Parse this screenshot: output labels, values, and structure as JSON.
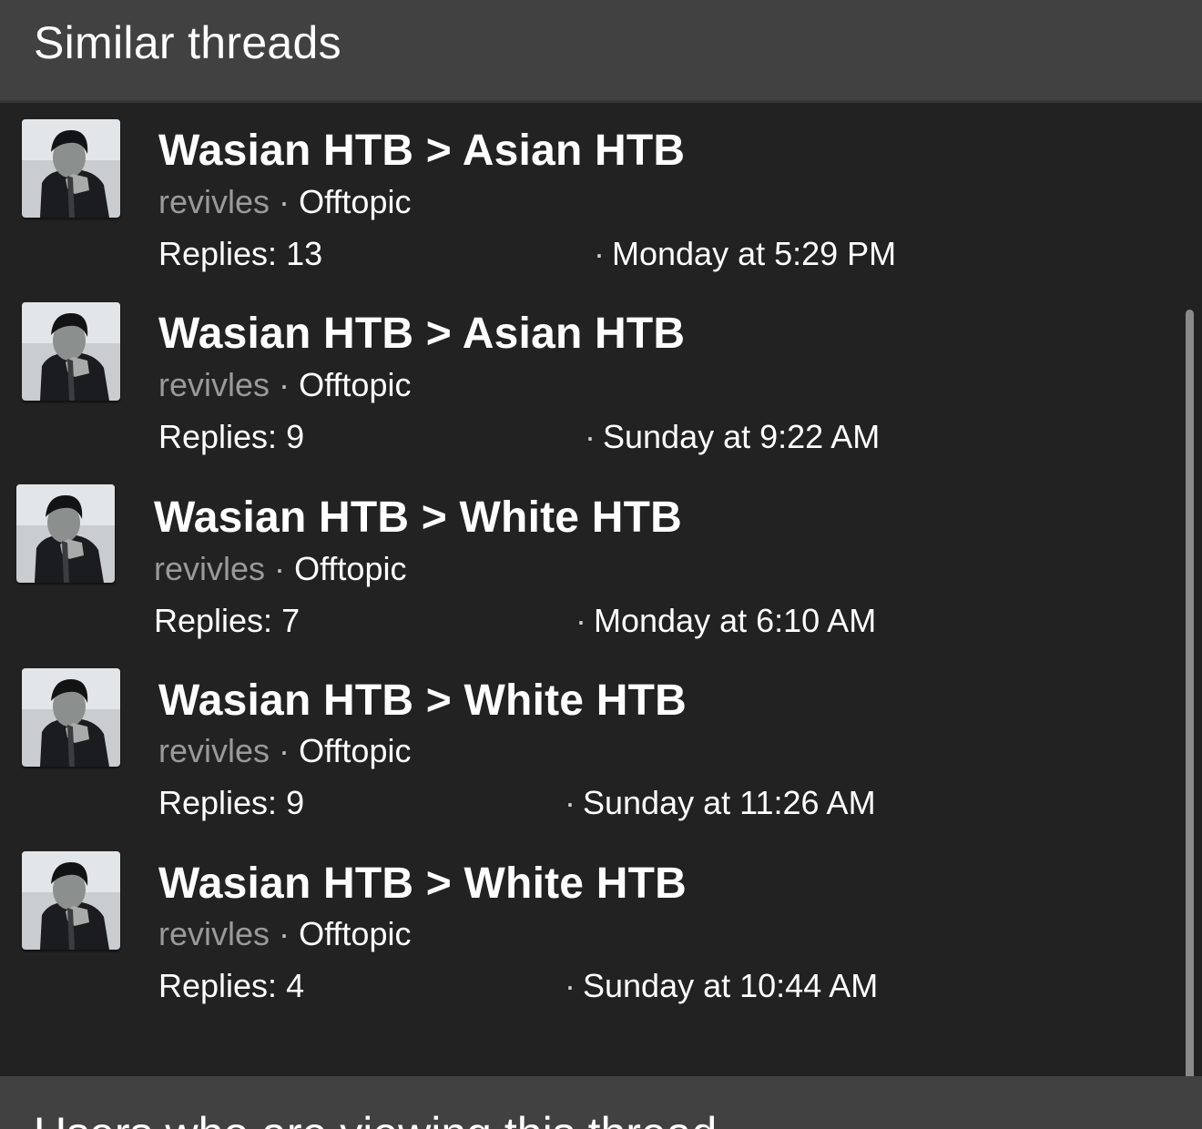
{
  "section": {
    "title": "Similar threads"
  },
  "threads": [
    {
      "title": "Wasian HTB > Asian HTB",
      "author": "revivles",
      "separator": "·",
      "forum": "Offtopic",
      "replies": "Replies: 13",
      "date": "Monday at 5:29 PM"
    },
    {
      "title": "Wasian HTB > Asian HTB",
      "author": "revivles",
      "separator": "·",
      "forum": "Offtopic",
      "replies": "Replies: 9",
      "date": "Sunday at 9:22 AM"
    },
    {
      "title": "Wasian HTB > White HTB",
      "author": "revivles",
      "separator": "·",
      "forum": "Offtopic",
      "replies": "Replies: 7",
      "date": "Monday at 6:10 AM"
    },
    {
      "title": "Wasian HTB > White HTB",
      "author": "revivles",
      "separator": "·",
      "forum": "Offtopic",
      "replies": "Replies: 9",
      "date": "Sunday at 11:26 AM"
    },
    {
      "title": "Wasian HTB > White HTB",
      "author": "revivles",
      "separator": "·",
      "forum": "Offtopic",
      "replies": "Replies: 4",
      "date": "Sunday at 10:44 AM"
    }
  ],
  "footer": {
    "title": "Users who are viewing this thread"
  },
  "colors": {
    "background": "#222222",
    "header": "#414141",
    "muted_text": "#9a9a9a"
  }
}
